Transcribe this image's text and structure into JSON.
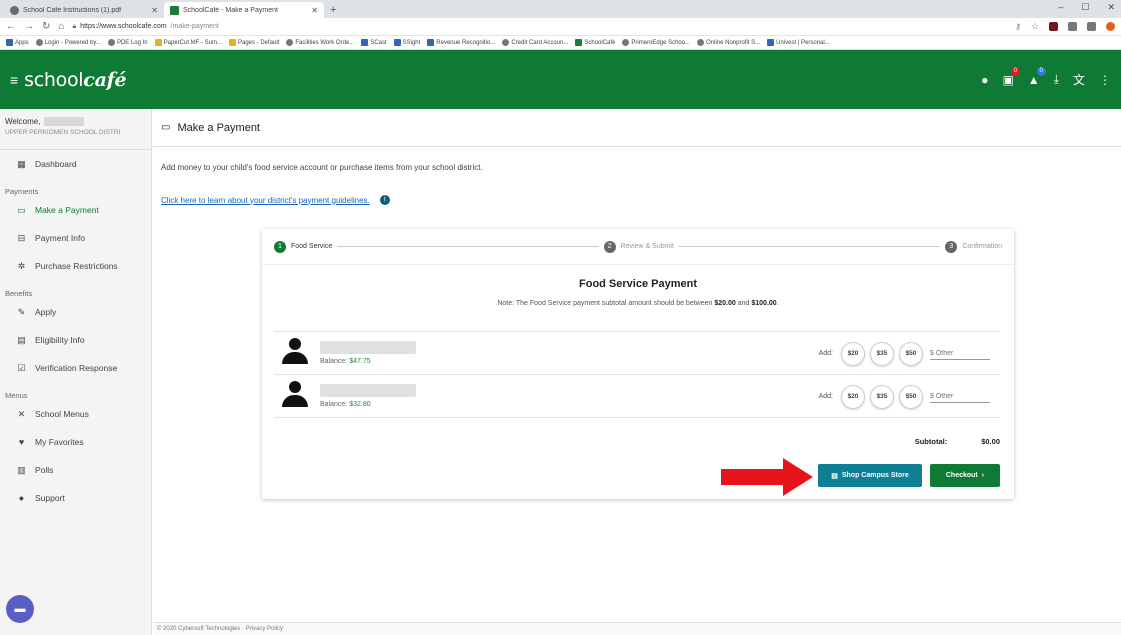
{
  "browser": {
    "tabs": [
      {
        "title": "School Cafe Instructions (1).pdf"
      },
      {
        "title": "SchoolCafé - Make a Payment"
      }
    ],
    "url_host": "https://www.schoolcafe.com",
    "url_path": "/make-payment",
    "bookmarks": [
      "Apps",
      "Login - Powered by...",
      "PDE Log In",
      "PaperCut MF - Sum...",
      "Pages - Default",
      "Facilities Work Orde...",
      "SCast",
      "SSight",
      "Revenue Recognitio...",
      "Credit Card Accoun...",
      "SchoolCafé",
      "PrimeroEdge Schoo...",
      "Online Nonprofit S...",
      "Univest | Personal..."
    ]
  },
  "app": {
    "logo_plain": "school",
    "logo_em": "café",
    "badges": {
      "cart": "0",
      "notifications": "0"
    },
    "colors": {
      "brand": "#0f7a33",
      "shop_button": "#0f7f95",
      "arrow": "#e8141b"
    }
  },
  "sidebar": {
    "welcome": "Welcome,",
    "district": "UPPER PERKIOMEN SCHOOL DISTRI",
    "items": {
      "dashboard": "Dashboard",
      "payments_section": "Payments",
      "make_payment": "Make a Payment",
      "payment_info": "Payment Info",
      "purchase_restrictions": "Purchase Restrictions",
      "benefits_section": "Benefits",
      "apply": "Apply",
      "eligibility_info": "Eligibility Info",
      "verification_response": "Verification Response",
      "menus_section": "Menus",
      "school_menus": "School Menus",
      "my_favorites": "My Favorites",
      "polls": "Polls",
      "support": "Support"
    }
  },
  "main": {
    "page_title": "Make a Payment",
    "intro": "Add money to your child's food service account or purchase items from your school district.",
    "guidelines_link": "Click here to learn about your district's payment guidelines.",
    "steps": [
      {
        "num": "1",
        "label": "Food Service"
      },
      {
        "num": "2",
        "label": "Review & Submit"
      },
      {
        "num": "3",
        "label": "Confirmation"
      }
    ],
    "card_title": "Food Service Payment",
    "note_prefix": "Note: The Food Service payment subtotal amount should be between",
    "note_min": "$20.00",
    "note_and": "and",
    "note_max": "$100.00",
    "note_suffix": ".",
    "students": [
      {
        "balance_label": "Balance:",
        "balance": "$47.75"
      },
      {
        "balance_label": "Balance:",
        "balance": "$32.80"
      }
    ],
    "add_label": "Add:",
    "amounts": [
      "$20",
      "$35",
      "$50"
    ],
    "other_placeholder": "$ Other",
    "subtotal_label": "Subtotal:",
    "subtotal_value": "$0.00",
    "shop_button": "Shop Campus Store",
    "checkout_button": "Checkout",
    "footer": "© 2020 Cybersoft Technologies · Privacy Policy"
  }
}
